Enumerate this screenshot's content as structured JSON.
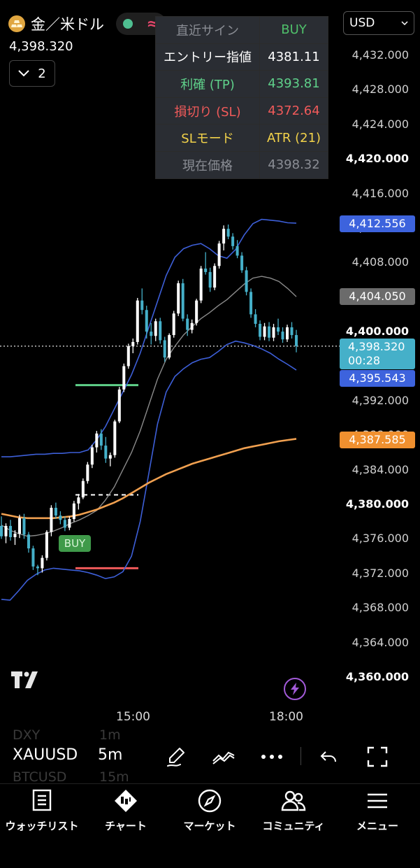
{
  "header": {
    "symbol_name": "金／米ドル",
    "last_price": "4,398.320",
    "indicator_count": "2",
    "currency": "USD"
  },
  "signal_table": [
    {
      "label": "直近サイン",
      "value": "BUY",
      "label_color": "#8a8d94",
      "value_color": "#4fbf6a"
    },
    {
      "label": "エントリー指値",
      "value": "4381.11",
      "label_color": "#ffffff",
      "value_color": "#ffffff"
    },
    {
      "label": "利確 (TP)",
      "value": "4393.81",
      "label_color": "#5fd08a",
      "value_color": "#5fd08a"
    },
    {
      "label": "損切り (SL)",
      "value": "4372.64",
      "label_color": "#f05a5a",
      "value_color": "#f05a5a"
    },
    {
      "label": "SLモード",
      "value": "ATR (21)",
      "label_color": "#f2d24a",
      "value_color": "#f2d24a"
    },
    {
      "label": "現在価格",
      "value": "4398.32",
      "label_color": "#8a8d94",
      "value_color": "#8a8d94"
    }
  ],
  "chart_data": {
    "type": "candlestick",
    "y_ticks": [
      "4,432.000",
      "4,428.000",
      "4,424.000",
      "4,420.000",
      "4,416.000",
      "4,412.556",
      "4,408.000",
      "4,404.050",
      "4,400.000",
      "4,392.000",
      "4,388.000",
      "4,384.000",
      "4,380.000",
      "4,376.000",
      "4,372.000",
      "4,368.000",
      "4,364.000",
      "4,360.000"
    ],
    "y_tick_values": [
      4432,
      4428,
      4424,
      4420,
      4416,
      4412,
      4408,
      4404,
      4400,
      4392,
      4388,
      4384,
      4380,
      4376,
      4372,
      4368,
      4364,
      4360
    ],
    "bold_ticks": [
      "4,420.000",
      "4,400.000",
      "4,380.000",
      "4,360.000"
    ],
    "y_range": [
      4357.5,
      4435.5
    ],
    "x_ticks": [
      "15:00",
      "18:00"
    ],
    "price_badges": {
      "upper_band": {
        "text": "4,412.556",
        "color": "#3d63dd"
      },
      "middle_band": {
        "text": "4,404.050",
        "color": "#6b6b6b"
      },
      "current_price": {
        "text": "4,398.320",
        "countdown": "00:28",
        "color": "#45b0c9"
      },
      "lower_band": {
        "text": "4,395.543",
        "color": "#3d63dd"
      },
      "slow_ma": {
        "text": "4,387.585",
        "color": "#f0902f"
      }
    },
    "buy_marker": {
      "text": "BUY",
      "price": 4375.5
    },
    "entry_level": 4381.1,
    "tp_level": 4393.8,
    "sl_level": 4372.6,
    "current_price": 4398.32,
    "candles": [
      [
        4377.5,
        4378.6,
        4376.0,
        4376.3
      ],
      [
        4376.3,
        4377.8,
        4375.5,
        4377.5
      ],
      [
        4377.5,
        4378.2,
        4375.8,
        4376.2
      ],
      [
        4376.2,
        4377.0,
        4375.3,
        4376.6
      ],
      [
        4376.6,
        4378.8,
        4376.1,
        4378.4
      ],
      [
        4378.4,
        4378.9,
        4376.0,
        4376.5
      ],
      [
        4376.5,
        4376.8,
        4374.4,
        4374.9
      ],
      [
        4374.9,
        4375.2,
        4372.4,
        4372.8
      ],
      [
        4372.8,
        4373.0,
        4371.8,
        4372.6
      ],
      [
        4372.6,
        4374.1,
        4372.1,
        4373.8
      ],
      [
        4373.8,
        4377.0,
        4373.5,
        4376.8
      ],
      [
        4376.8,
        4379.9,
        4376.3,
        4379.6
      ],
      [
        4379.6,
        4380.2,
        4378.3,
        4378.7
      ],
      [
        4378.7,
        4379.2,
        4377.7,
        4378.2
      ],
      [
        4378.2,
        4378.6,
        4376.9,
        4377.3
      ],
      [
        4377.3,
        4378.6,
        4377.0,
        4378.3
      ],
      [
        4378.3,
        4380.4,
        4378.0,
        4380.1
      ],
      [
        4380.1,
        4381.2,
        4379.4,
        4380.8
      ],
      [
        4380.8,
        4383.0,
        4380.6,
        4382.7
      ],
      [
        4382.7,
        4384.9,
        4382.4,
        4384.6
      ],
      [
        4384.6,
        4386.9,
        4384.2,
        4386.6
      ],
      [
        4386.6,
        4388.5,
        4386.0,
        4388.2
      ],
      [
        4388.2,
        4388.7,
        4386.3,
        4386.8
      ],
      [
        4386.8,
        4387.8,
        4384.8,
        4385.3
      ],
      [
        4385.3,
        4386.0,
        4384.4,
        4385.7
      ],
      [
        4385.7,
        4389.8,
        4385.4,
        4389.6
      ],
      [
        4389.6,
        4393.6,
        4389.4,
        4393.3
      ],
      [
        4393.3,
        4396.3,
        4393.0,
        4396.0
      ],
      [
        4396.0,
        4398.6,
        4395.7,
        4398.3
      ],
      [
        4398.3,
        4399.2,
        4397.5,
        4398.8
      ],
      [
        4398.8,
        4403.9,
        4398.5,
        4403.6
      ],
      [
        4403.6,
        4405.0,
        4402.0,
        4402.5
      ],
      [
        4402.5,
        4403.0,
        4399.2,
        4400.0
      ],
      [
        4400.0,
        4401.0,
        4398.5,
        4399.5
      ],
      [
        4399.5,
        4401.5,
        4398.9,
        4401.2
      ],
      [
        4401.2,
        4401.6,
        4398.6,
        4399.0
      ],
      [
        4399.0,
        4399.4,
        4396.5,
        4397.0
      ],
      [
        4397.0,
        4399.8,
        4396.8,
        4399.6
      ],
      [
        4399.6,
        4402.4,
        4399.3,
        4402.1
      ],
      [
        4402.1,
        4405.9,
        4401.8,
        4405.6
      ],
      [
        4405.6,
        4406.1,
        4401.2,
        4401.5
      ],
      [
        4401.5,
        4402.0,
        4399.5,
        4400.2
      ],
      [
        4400.2,
        4401.4,
        4399.8,
        4401.0
      ],
      [
        4401.0,
        4403.8,
        4400.7,
        4403.6
      ],
      [
        4403.6,
        4407.6,
        4403.3,
        4407.3
      ],
      [
        4407.3,
        4409.2,
        4406.6,
        4406.9
      ],
      [
        4406.9,
        4407.4,
        4404.6,
        4405.1
      ],
      [
        4405.1,
        4407.9,
        4404.8,
        4407.6
      ],
      [
        4407.6,
        4410.5,
        4407.3,
        4410.2
      ],
      [
        4410.2,
        4412.3,
        4409.4,
        4411.9
      ],
      [
        4411.9,
        4412.4,
        4410.7,
        4411.0
      ],
      [
        4411.0,
        4411.4,
        4409.5,
        4409.9
      ],
      [
        4409.9,
        4410.6,
        4408.5,
        4408.8
      ],
      [
        4408.8,
        4409.2,
        4406.8,
        4407.1
      ],
      [
        4407.1,
        4407.5,
        4404.2,
        4404.6
      ],
      [
        4404.6,
        4405.0,
        4401.6,
        4402.0
      ],
      [
        4402.0,
        4402.6,
        4400.5,
        4400.9
      ],
      [
        4400.9,
        4401.3,
        4399.0,
        4399.4
      ],
      [
        4399.4,
        4401.0,
        4399.0,
        4400.6
      ],
      [
        4400.6,
        4401.1,
        4398.9,
        4399.3
      ],
      [
        4399.3,
        4400.9,
        4398.9,
        4400.5
      ],
      [
        4400.5,
        4401.5,
        4399.6,
        4400.0
      ],
      [
        4400.0,
        4400.5,
        4398.7,
        4399.1
      ],
      [
        4399.1,
        4400.8,
        4398.8,
        4400.5
      ],
      [
        4400.5,
        4401.1,
        4399.2,
        4399.6
      ],
      [
        4399.6,
        4400.2,
        4397.6,
        4398.32
      ]
    ],
    "upper_band": [
      4385.5,
      4385.5,
      4385.6,
      4385.7,
      4385.8,
      4385.8,
      4385.9,
      4385.9,
      4386.0,
      4386.0,
      4386.3,
      4387.5,
      4389.0,
      4391.0,
      4393.0,
      4395.0,
      4397.5,
      4400.5,
      4403.5,
      4406.5,
      4408.6,
      4409.6,
      4410.0,
      4410.2,
      4409.6,
      4408.8,
      4408.5,
      4409.5,
      4411.2,
      4412.5,
      4413.0,
      4412.9,
      4412.8,
      4412.6,
      4412.556
    ],
    "middle_band": [
      4377.6,
      4377.0,
      4376.6,
      4376.3,
      4376.4,
      4376.6,
      4376.9,
      4377.3,
      4377.8,
      4378.2,
      4378.7,
      4379.3,
      4380.5,
      4382.0,
      4384.0,
      4386.0,
      4388.5,
      4391.5,
      4394.5,
      4396.8,
      4398.3,
      4399.6,
      4400.6,
      4401.5,
      4402.2,
      4403.0,
      4403.7,
      4404.6,
      4405.5,
      4406.2,
      4406.4,
      4406.2,
      4405.8,
      4405.0,
      4404.05
    ],
    "lower_band": [
      4369.0,
      4368.9,
      4370.0,
      4371.2,
      4371.9,
      4372.4,
      4372.6,
      4372.5,
      4372.4,
      4372.3,
      4372.1,
      4371.8,
      4371.4,
      4371.6,
      4372.2,
      4374.0,
      4378.0,
      4383.6,
      4389.3,
      4393.0,
      4394.8,
      4395.7,
      4396.4,
      4396.8,
      4397.0,
      4397.7,
      4398.5,
      4398.9,
      4398.7,
      4398.4,
      4398.0,
      4397.5,
      4396.8,
      4396.2,
      4395.543
    ],
    "slow_ma": [
      4378.9,
      4378.7,
      4378.5,
      4378.4,
      4378.4,
      4378.4,
      4378.4,
      4378.5,
      4378.6,
      4378.8,
      4379.1,
      4379.4,
      4379.8,
      4380.2,
      4380.7,
      4381.3,
      4381.9,
      4382.5,
      4383.0,
      4383.5,
      4383.9,
      4384.3,
      4384.7,
      4385.0,
      4385.3,
      4385.6,
      4385.9,
      4386.2,
      4386.5,
      4386.7,
      4386.9,
      4387.1,
      4387.3,
      4387.45,
      4387.585
    ]
  },
  "toolbar": {
    "symbol": "XAUUSD",
    "interval": "5m",
    "ghost_symbol_above": "DXY",
    "ghost_interval_above": "1m",
    "ghost_symbol_below": "BTCUSD",
    "ghost_interval_below": "15m"
  },
  "bottom_nav": [
    {
      "label": "ウォッチリスト",
      "icon": "watchlist-icon"
    },
    {
      "label": "チャート",
      "icon": "chart-icon"
    },
    {
      "label": "マーケット",
      "icon": "compass-icon"
    },
    {
      "label": "コミュニティ",
      "icon": "community-icon"
    },
    {
      "label": "メニュー",
      "icon": "menu-icon"
    }
  ]
}
